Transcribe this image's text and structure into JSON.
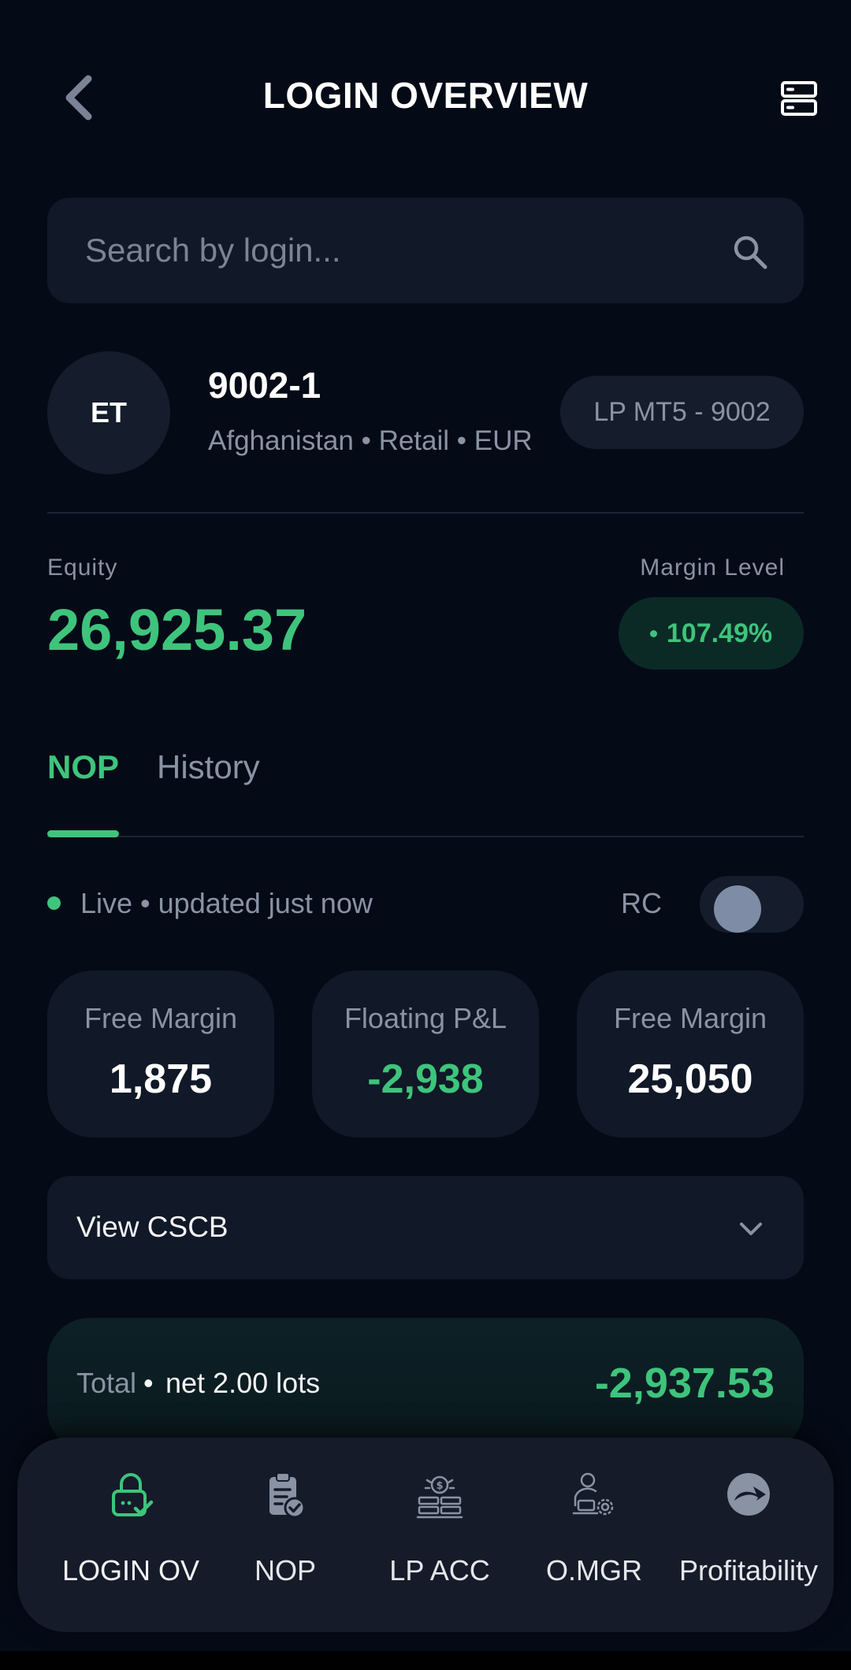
{
  "header": {
    "title": "LOGIN OVERVIEW",
    "back_icon": "chevron-left-icon",
    "menu_icon": "server-list-icon"
  },
  "search": {
    "placeholder": "Search by login...",
    "value": "",
    "icon": "search-icon"
  },
  "account": {
    "initials": "ET",
    "login": "9002-1",
    "meta": "Afghanistan • Retail • EUR",
    "tag": "LP MT5 - 9002"
  },
  "equity": {
    "label": "Equity",
    "value": "26,925.37"
  },
  "margin_level": {
    "label": "Margin Level",
    "value": "107.49%"
  },
  "tabs": [
    {
      "label": "NOP",
      "active": true
    },
    {
      "label": "History",
      "active": false
    }
  ],
  "status": {
    "live_text": "Live • updated just now",
    "rc_label": "RC",
    "rc_enabled": false
  },
  "stats": [
    {
      "label": "Free Margin",
      "value": "1,875"
    },
    {
      "label": "Floating P&L",
      "value": "-2,938"
    },
    {
      "label": "Free Margin",
      "value": "25,050"
    }
  ],
  "cscb": {
    "label": "View CSCB",
    "icon": "chevron-down-icon"
  },
  "total": {
    "label": "Total",
    "separator": "•",
    "lots": "net 2.00 lots",
    "value": "-2,937.53"
  },
  "nav": [
    {
      "label": "LOGIN OV",
      "icon": "lock-check-icon",
      "active": true
    },
    {
      "label": "NOP",
      "icon": "clipboard-check-icon",
      "active": false
    },
    {
      "label": "LP ACC",
      "icon": "money-stack-icon",
      "active": false
    },
    {
      "label": "O.MGR",
      "icon": "user-gear-icon",
      "active": false
    },
    {
      "label": "Profitability",
      "icon": "profitability-logo-icon",
      "active": false
    }
  ],
  "colors": {
    "background": "#050a17",
    "card": "#111827",
    "accent_green": "#3ec47c",
    "muted_text": "#8a93a3"
  }
}
